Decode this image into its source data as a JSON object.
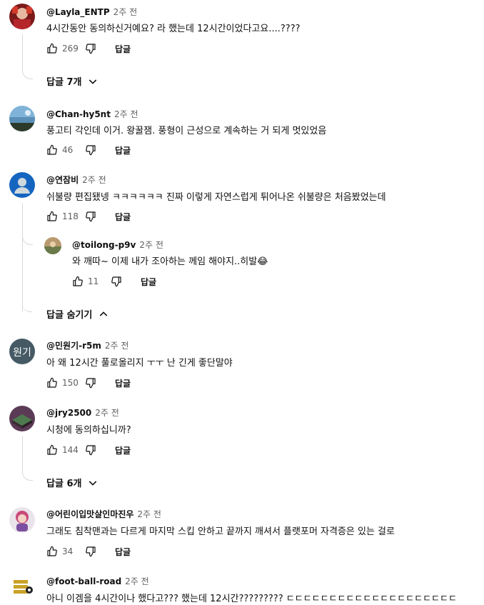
{
  "comments": [
    {
      "handle": "@Layla_ENTP",
      "time": "2주 전",
      "text": "4시간동안 동의하신거예요? 라 했는데 12시간이었다고요....????",
      "likes": "269",
      "reply": "답글"
    },
    {
      "handle": "@Chan-hy5nt",
      "time": "2주 전",
      "text": "풍고티 각인데 이거. 왕꿀잼. 풍형이 근성으로 계속하는 거 되게 멋있었음",
      "likes": "46",
      "reply": "답글"
    },
    {
      "handle": "@연잠비",
      "time": "2주 전",
      "text": "쉬불량 편집됐넹 ㅋㅋㅋㅋㅋㅋ 진짜 이렇게 자연스럽게 튀어나온 쉬불량은 처음봤었는데",
      "likes": "118",
      "reply": "답글"
    },
    {
      "handle": "@민원기-r5m",
      "time": "2주 전",
      "text": "아 왜 12시간 풀로올리지 ㅜㅜ 난 긴게 좋단말야",
      "likes": "150",
      "reply": "답글",
      "avatar_text": "원기",
      "avatar_color": "#455a64"
    },
    {
      "handle": "@jry2500",
      "time": "2주 전",
      "text": "시청에 동의하십니까?",
      "likes": "144",
      "reply": "답글"
    },
    {
      "handle": "@어린이입맛살인마진우",
      "time": "2주 전",
      "text": "그래도 침착맨과는 다르게 마지막 스킵 안하고 끝까지 깨셔서 플랫포머 자격증은 있는 걸로",
      "likes": "34",
      "reply": "답글"
    },
    {
      "handle": "@foot-ball-road",
      "time": "2주 전",
      "text": "아니 이겜을 4시간이나 했다고??? 했는데 12시간????????? ㄷㄷㄷㄷㄷㄷㄷㄷㄷㄷㄷㄷㄷㄷㄷㄷㄷㄷㄷㄷ"
    }
  ],
  "reply_comment": {
    "handle": "@toilong-p9v",
    "time": "2주 전",
    "text": "와 깨따~ 이제 내가 조아하는 께임 해야지..히발",
    "emoji": "😂",
    "likes": "11",
    "reply": "답글"
  },
  "toggles": {
    "layla": "답글 7개",
    "yeonjambi": "답글 숨기기",
    "jry": "답글 6개"
  },
  "icons": {
    "like": "thumbs-up-icon",
    "dislike": "thumbs-down-icon",
    "expand": "chevron-down-icon",
    "collapse": "chevron-up-icon"
  }
}
